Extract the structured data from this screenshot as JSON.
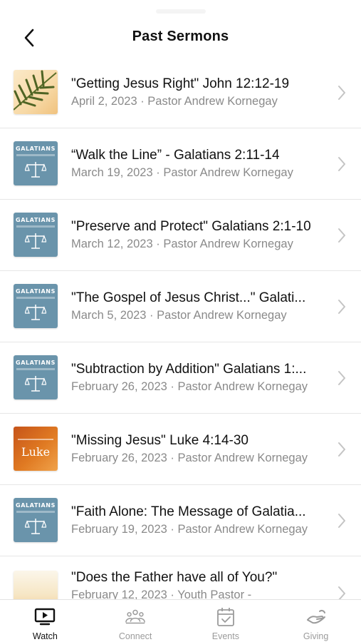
{
  "header": {
    "title": "Past Sermons"
  },
  "sermons": [
    {
      "title": "\"Getting Jesus Right\"  John 12:12-19",
      "subtitle": "April 2, 2023 · Pastor Andrew Kornegay",
      "thumb": "palm"
    },
    {
      "title": "“Walk the Line” - Galatians 2:11-14",
      "subtitle": "March 19, 2023 · Pastor Andrew Kornegay",
      "thumb": "galatians"
    },
    {
      "title": "\"Preserve and Protect\" Galatians 2:1-10",
      "subtitle": "March 12, 2023 · Pastor Andrew Kornegay",
      "thumb": "galatians"
    },
    {
      "title": "\"The Gospel of Jesus Christ...\"  Galati...",
      "subtitle": "March 5, 2023 · Pastor Andrew Kornegay",
      "thumb": "galatians"
    },
    {
      "title": "\"Subtraction by Addition\" Galatians 1:...",
      "subtitle": "February 26, 2023 · Pastor Andrew Kornegay",
      "thumb": "galatians"
    },
    {
      "title": "\"Missing Jesus\"  Luke 4:14-30",
      "subtitle": "February 26, 2023 · Pastor Andrew Kornegay",
      "thumb": "luke"
    },
    {
      "title": "\"Faith Alone: The Message of Galatia...",
      "subtitle": "February 19, 2023 · Pastor Andrew Kornegay",
      "thumb": "galatians"
    },
    {
      "title": "\"Does the Father have all of You?\"",
      "subtitle": "February 12, 2023 · Youth Pastor -",
      "thumb": "sunset"
    }
  ],
  "thumb_text": {
    "galatians": "GALATIANS",
    "luke": "Luke"
  },
  "tabs": [
    {
      "label": "Watch",
      "icon": "tv-play-icon",
      "active": true
    },
    {
      "label": "Connect",
      "icon": "people-icon",
      "active": false
    },
    {
      "label": "Events",
      "icon": "calendar-check-icon",
      "active": false
    },
    {
      "label": "Giving",
      "icon": "hand-giving-icon",
      "active": false
    }
  ],
  "colors": {
    "accent": "#111111",
    "inactive": "#9b9b9b",
    "galatians_bg": "#6a94ab",
    "divider": "#e6e6e6"
  }
}
